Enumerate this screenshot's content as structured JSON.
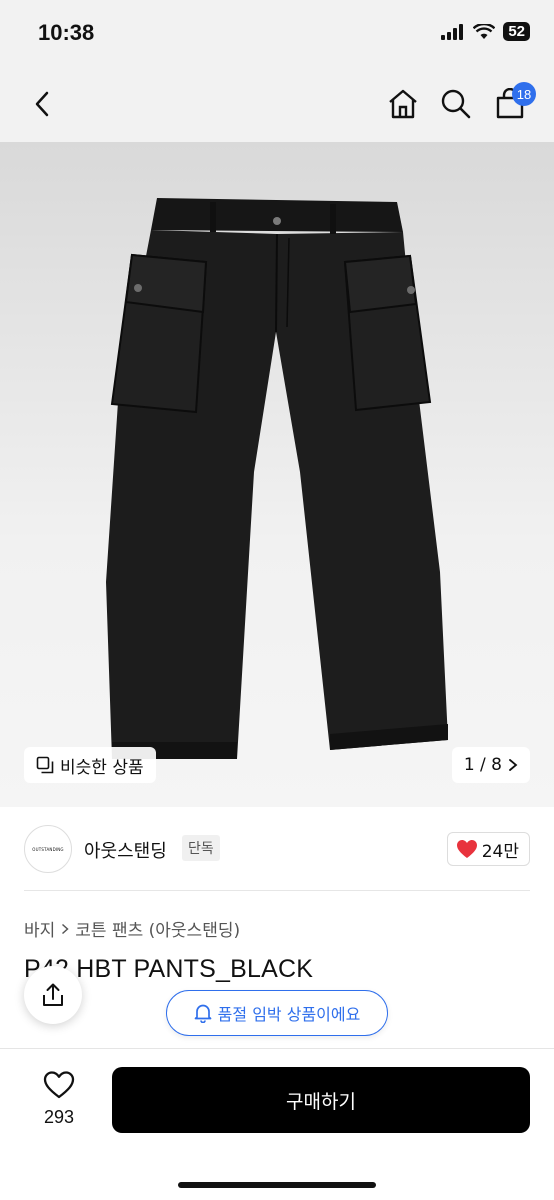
{
  "status_bar": {
    "time": "10:38",
    "battery": "52"
  },
  "nav": {
    "cart_count": "18"
  },
  "gallery": {
    "similar_label": "비슷한 상품",
    "pager": "1 / 8"
  },
  "brand": {
    "logo_text": "OUTSTANDING",
    "name": "아웃스탠딩",
    "tag": "단독",
    "likes": "24만"
  },
  "breadcrumb": {
    "category": "바지",
    "subcategory": "코튼 팬츠 (아웃스탠딩)"
  },
  "product": {
    "title": "P42 HBT PANTS_BLACK"
  },
  "alert": {
    "label": "품절 임박 상품이에요"
  },
  "bottom": {
    "wish_count": "293",
    "buy_label": "구매하기"
  },
  "colors": {
    "accent": "#2f6fec",
    "heart": "#e8333d",
    "buy_button": "#000000"
  }
}
